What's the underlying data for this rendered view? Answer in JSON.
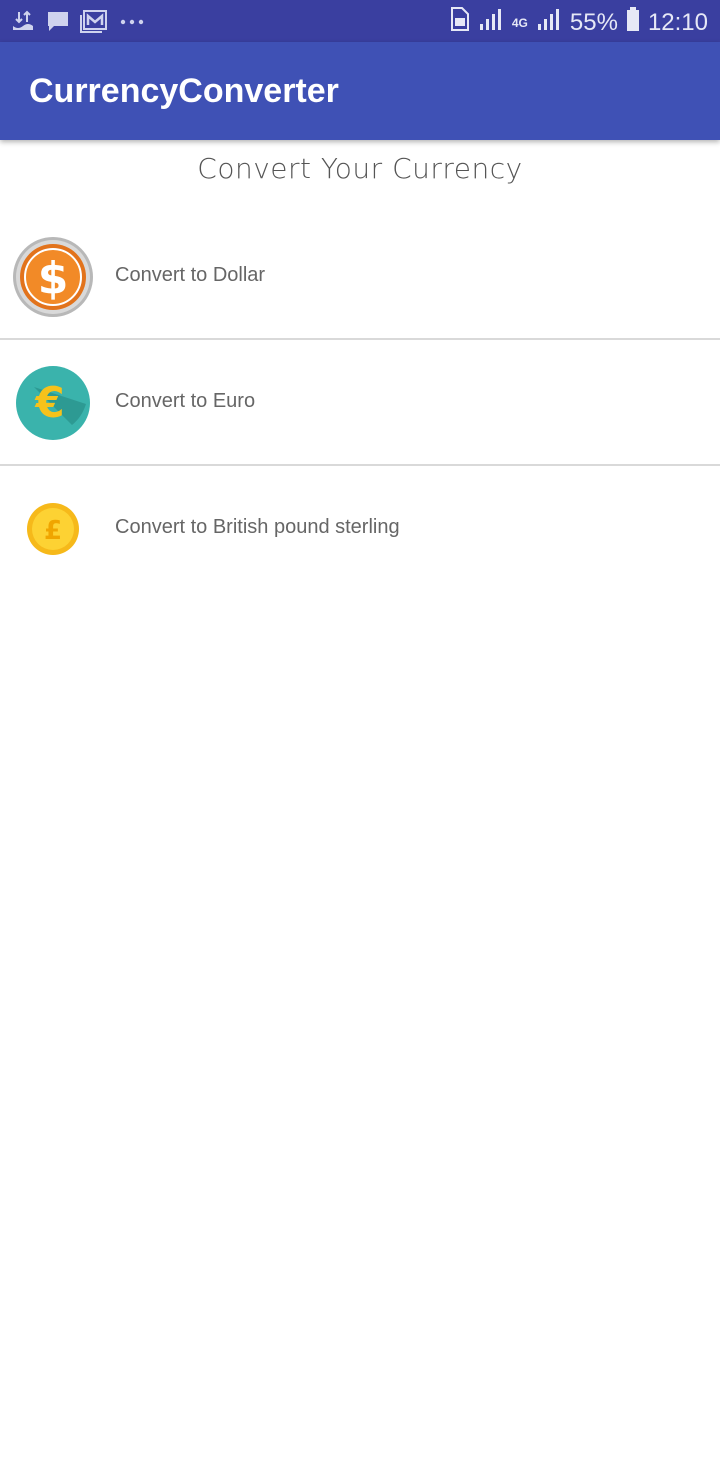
{
  "status_bar": {
    "battery": "55%",
    "time": "12:10",
    "network": "4G",
    "icons": [
      "transfer-icon",
      "chat-icon",
      "mail-icon",
      "more-dots-icon",
      "sim-icon",
      "signal-icon",
      "signal-icon",
      "battery-icon"
    ]
  },
  "app_bar": {
    "title": "CurrencyConverter",
    "color": "#3f51b5"
  },
  "heading": "Convert Your Currency",
  "items": [
    {
      "label": "Convert to Dollar",
      "icon": "dollar-coin-icon"
    },
    {
      "label": "Convert to Euro",
      "icon": "euro-coin-icon"
    },
    {
      "label": "Convert to British pound sterling",
      "icon": "pound-coin-icon"
    }
  ]
}
